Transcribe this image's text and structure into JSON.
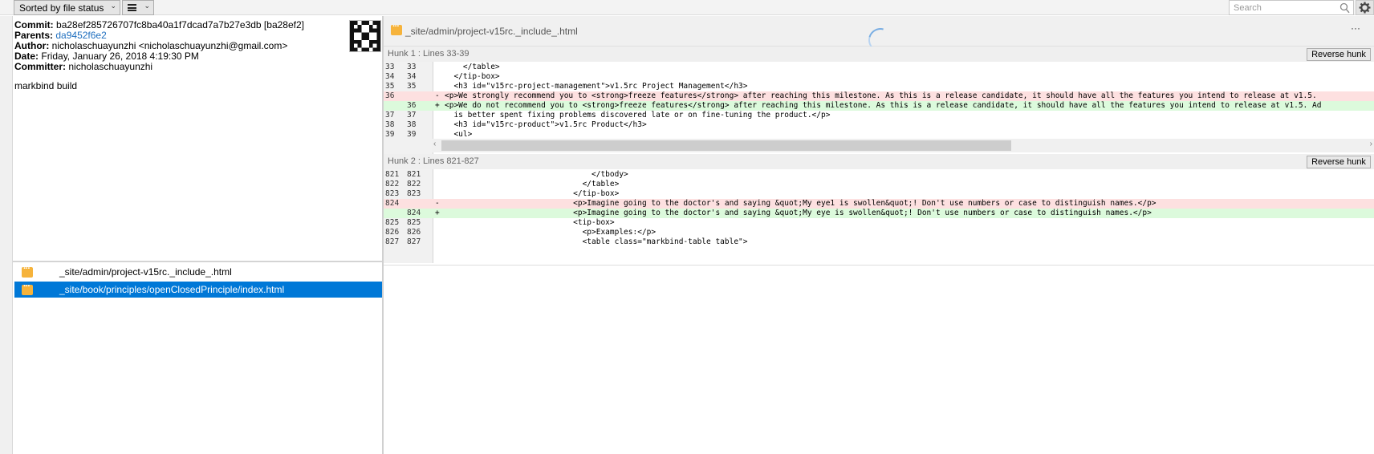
{
  "toolbar": {
    "sort_label": "Sorted by file status",
    "search_placeholder": "Search"
  },
  "commit": {
    "commit_label": "Commit:",
    "commit_value": "ba28ef285726707fc8ba40a1f7dcad7a7b27e3db [ba28ef2]",
    "parents_label": "Parents:",
    "parents_value": "da9452f6e2",
    "author_label": "Author:",
    "author_value": "nicholaschuayunzhi <nicholaschuayunzhi@gmail.com>",
    "date_label": "Date:",
    "date_value": "Friday, January 26, 2018 4:19:30 PM",
    "committer_label": "Committer:",
    "committer_value": "nicholaschuayunzhi",
    "message": "markbind build"
  },
  "files": [
    {
      "name": "_site/admin/project-v15rc._include_.html",
      "selected": false
    },
    {
      "name": "_site/book/principles/openClosedPrinciple/index.html",
      "selected": true
    }
  ],
  "diff": {
    "file_path": "_site/admin/project-v15rc._include_.html",
    "more_label": "···",
    "reverse_label": "Reverse hunk",
    "hunks": [
      {
        "title": "Hunk 1 : Lines 33-39",
        "lines": [
          {
            "old": "33",
            "new": "33",
            "sign": " ",
            "type": "context",
            "text": "    </table>"
          },
          {
            "old": "34",
            "new": "34",
            "sign": " ",
            "type": "context",
            "text": "  </tip-box>"
          },
          {
            "old": "35",
            "new": "35",
            "sign": " ",
            "type": "context",
            "text": "  <h3 id=\"v15rc-project-management\">v1.5rc Project Management</h3>"
          },
          {
            "old": "36",
            "new": "",
            "sign": "-",
            "type": "removed",
            "text": "<p>We strongly recommend you to <strong>freeze features</strong> after reaching this milestone. As this is a release candidate, it should have all the features you intend to release at v1.5."
          },
          {
            "old": "",
            "new": "36",
            "sign": "+",
            "type": "added",
            "text": "<p>We do not recommend you to <strong>freeze features</strong> after reaching this milestone. As this is a release candidate, it should have all the features you intend to release at v1.5. Ad"
          },
          {
            "old": "37",
            "new": "37",
            "sign": " ",
            "type": "context",
            "text": "  is better spent fixing problems discovered late or on fine-tuning the product.</p>"
          },
          {
            "old": "38",
            "new": "38",
            "sign": " ",
            "type": "context",
            "text": "  <h3 id=\"v15rc-product\">v1.5rc Product</h3>"
          },
          {
            "old": "39",
            "new": "39",
            "sign": " ",
            "type": "context",
            "text": "  <ul>"
          }
        ]
      },
      {
        "title": "Hunk 2 : Lines 821-827",
        "lines": [
          {
            "old": "821",
            "new": "821",
            "sign": " ",
            "type": "context",
            "text": "                                </tbody>"
          },
          {
            "old": "822",
            "new": "822",
            "sign": " ",
            "type": "context",
            "text": "                              </table>"
          },
          {
            "old": "823",
            "new": "823",
            "sign": " ",
            "type": "context",
            "text": "                            </tip-box>"
          },
          {
            "old": "824",
            "new": "",
            "sign": "-",
            "type": "removed",
            "text": "                            <p>Imagine going to the doctor's and saying &quot;My eye1 is swollen&quot;! Don't use numbers or case to distinguish names.</p>"
          },
          {
            "old": "",
            "new": "824",
            "sign": "+",
            "type": "added",
            "text": "                            <p>Imagine going to the doctor's and saying &quot;My eye is swollen&quot;! Don't use numbers or case to distinguish names.</p>"
          },
          {
            "old": "825",
            "new": "825",
            "sign": " ",
            "type": "context",
            "text": "                            <tip-box>"
          },
          {
            "old": "826",
            "new": "826",
            "sign": " ",
            "type": "context",
            "text": "                              <p>Examples:</p>"
          },
          {
            "old": "827",
            "new": "827",
            "sign": " ",
            "type": "context",
            "text": "                              <table class=\"markbind-table table\">"
          }
        ]
      }
    ]
  }
}
